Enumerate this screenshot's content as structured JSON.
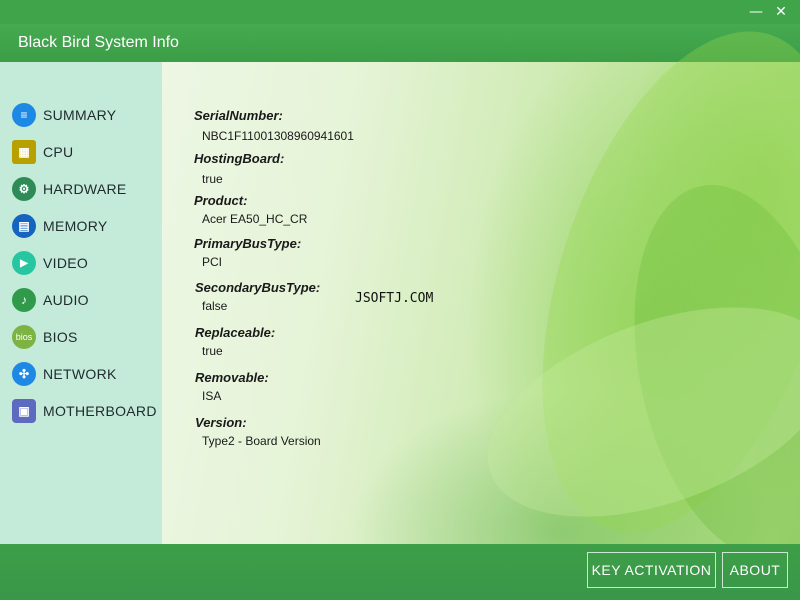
{
  "window": {
    "title": "Black Bird System Info",
    "minimize_glyph": "—",
    "close_glyph": "✕"
  },
  "sidebar": {
    "items": [
      {
        "label": "SUMMARY",
        "icon": "summary-icon",
        "color": "#1e88e5",
        "glyph": "≡"
      },
      {
        "label": "CPU",
        "icon": "cpu-icon",
        "color": "#b8a000",
        "glyph": "▦"
      },
      {
        "label": "HARDWARE",
        "icon": "hardware-icon",
        "color": "#2e8b57",
        "glyph": "⚙"
      },
      {
        "label": "MEMORY",
        "icon": "memory-icon",
        "color": "#1565c0",
        "glyph": "▤"
      },
      {
        "label": "VIDEO",
        "icon": "video-icon",
        "color": "#26c6a0",
        "glyph": "▶"
      },
      {
        "label": "AUDIO",
        "icon": "audio-icon",
        "color": "#2e9a4a",
        "glyph": "♪"
      },
      {
        "label": "BIOS",
        "icon": "bios-icon",
        "color": "#7cb342",
        "glyph": "bios"
      },
      {
        "label": "NETWORK",
        "icon": "network-icon",
        "color": "#1e88e5",
        "glyph": "✣"
      },
      {
        "label": "MOTHERBOARD",
        "icon": "motherboard-icon",
        "color": "#5c6bc0",
        "glyph": "▣"
      }
    ]
  },
  "details": {
    "fields": [
      {
        "label": "SerialNumber:",
        "value": "NBC1F11001308960941601"
      },
      {
        "label": "HostingBoard:",
        "value": "true"
      },
      {
        "label": "Product:",
        "value": "Acer EA50_HC_CR"
      },
      {
        "label": "PrimaryBusType:",
        "value": "PCI"
      },
      {
        "label": "SecondaryBusType:",
        "value": "false"
      },
      {
        "label": "Replaceable:",
        "value": "true"
      },
      {
        "label": "Removable:",
        "value": "ISA"
      },
      {
        "label": "Version:",
        "value": "Type2 - Board Version"
      }
    ]
  },
  "watermark": "JSOFTJ.COM",
  "footer": {
    "key_activation_label": "KEY ACTIVATION",
    "about_label": "ABOUT"
  },
  "colors": {
    "accent_green": "#3fa44a",
    "sidebar_bg": "#c4ebd9"
  }
}
